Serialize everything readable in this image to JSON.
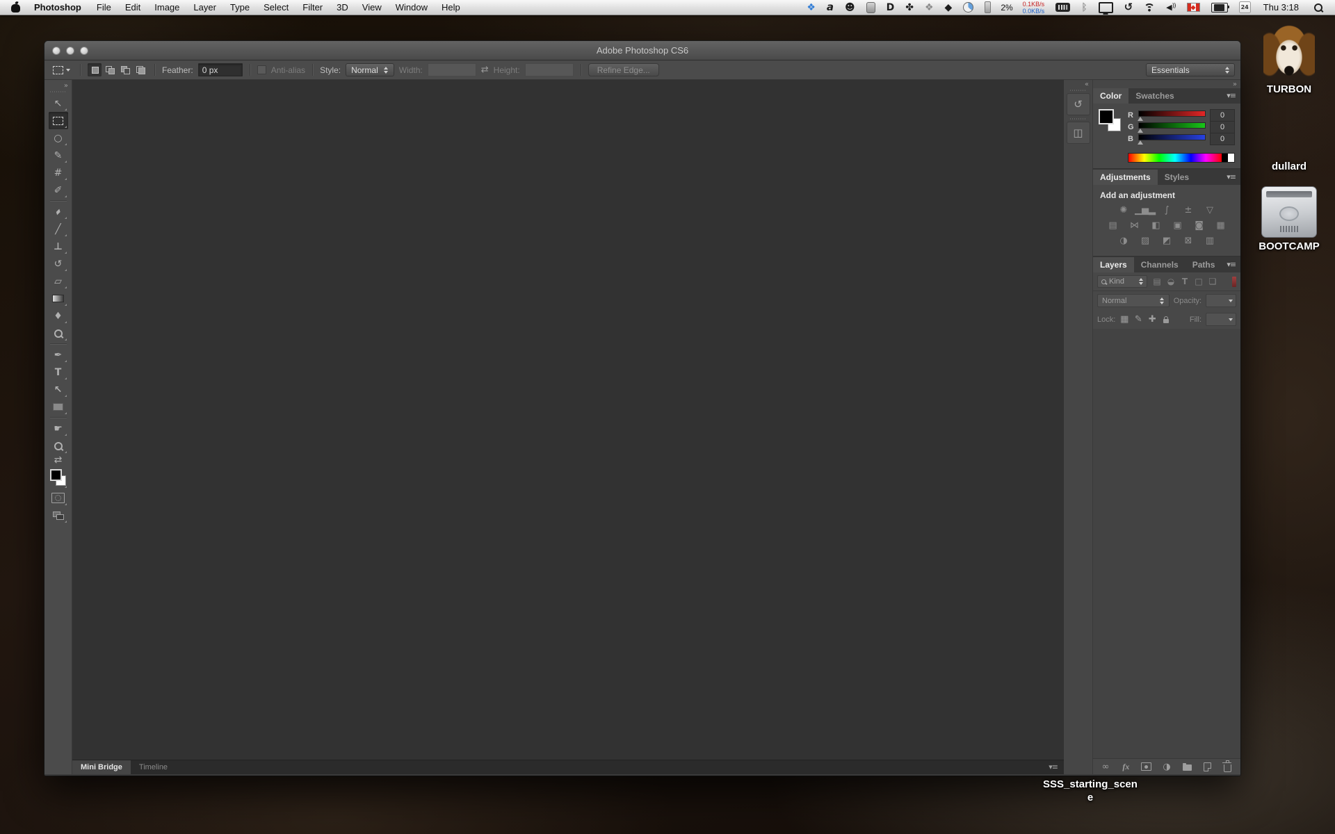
{
  "glyphs": {
    "collapse_right": "»",
    "collapse_left": "«",
    "panel_menu": "▾≡",
    "swap_dims": "⇄"
  },
  "menu_bar": {
    "menus": [
      {
        "name": "menu-photoshop",
        "label": "Photoshop",
        "cls": "bold"
      },
      {
        "name": "menu-file",
        "label": "File",
        "cls": ""
      },
      {
        "name": "menu-edit",
        "label": "Edit",
        "cls": ""
      },
      {
        "name": "menu-image",
        "label": "Image",
        "cls": ""
      },
      {
        "name": "menu-layer",
        "label": "Layer",
        "cls": ""
      },
      {
        "name": "menu-type",
        "label": "Type",
        "cls": ""
      },
      {
        "name": "menu-select",
        "label": "Select",
        "cls": ""
      },
      {
        "name": "menu-filter",
        "label": "Filter",
        "cls": ""
      },
      {
        "name": "menu-3d",
        "label": "3D",
        "cls": ""
      },
      {
        "name": "menu-view",
        "label": "View",
        "cls": ""
      },
      {
        "name": "menu-window",
        "label": "Window",
        "cls": ""
      },
      {
        "name": "menu-help",
        "label": "Help",
        "cls": ""
      }
    ],
    "status_icons_a": [
      {
        "name": "dropbox-icon",
        "glyph": "❖",
        "cls": "c-dropbox"
      },
      {
        "name": "alfred-icon",
        "glyph": "a",
        "cls": "c-dark italic"
      },
      {
        "name": "user-silhouette-icon",
        "glyph": "☻",
        "cls": "c-dark"
      },
      {
        "name": "drive-slab-icon",
        "glyph": "",
        "cls": "shape-slab"
      },
      {
        "name": "d-app-icon",
        "glyph": "D",
        "cls": "c-dark boldg"
      },
      {
        "name": "paw-icon",
        "glyph": "✤",
        "cls": "c-dark"
      },
      {
        "name": "diamond-dots-icon",
        "glyph": "❖",
        "cls": "c-grey"
      },
      {
        "name": "cube-icon",
        "glyph": "◆",
        "cls": "c-dark"
      },
      {
        "name": "pie-chart-icon",
        "glyph": "",
        "cls": "shape-pie"
      },
      {
        "name": "meter-icon",
        "glyph": "",
        "cls": "shape-meter"
      }
    ],
    "cpu_percent": "2%",
    "net_up": "0.1KB/s",
    "net_down": "0.0KB/s",
    "status_icons_b": [
      {
        "name": "memory-icon",
        "glyph": "",
        "cls": "shape-memory"
      },
      {
        "name": "bluetooth-icon",
        "glyph": "ᛒ",
        "cls": "c-dim boldg"
      },
      {
        "name": "display-icon",
        "glyph": "",
        "cls": "shape-display"
      },
      {
        "name": "time-machine-icon",
        "glyph": "↺",
        "cls": "c-dark tm"
      },
      {
        "name": "wifi-icon",
        "glyph": "",
        "cls": "shape-wifi"
      },
      {
        "name": "volume-icon",
        "glyph": "◀",
        "cls": "c-dark vol"
      },
      {
        "name": "canada-flag-icon",
        "glyph": "",
        "cls": "shape-flag"
      },
      {
        "name": "battery-icon",
        "glyph": "",
        "cls": "shape-battery"
      },
      {
        "name": "calendar-icon",
        "glyph": "24",
        "cls": "shape-calendar"
      }
    ],
    "clock": "Thu 3:18"
  },
  "window": {
    "title": "Adobe Photoshop CS6",
    "options_bar": {
      "selection_modes": [
        {
          "name": "new-selection-button",
          "cls": "pressed",
          "shape": "sm-new"
        },
        {
          "name": "add-to-selection-button",
          "cls": "",
          "shape": "sm-add"
        },
        {
          "name": "subtract-from-selection-button",
          "cls": "",
          "shape": "sm-sub"
        },
        {
          "name": "intersect-selection-button",
          "cls": "",
          "shape": "sm-int"
        }
      ],
      "feather_label": "Feather:",
      "feather_value": "0 px",
      "antialias_label": "Anti-alias",
      "style_label": "Style:",
      "style_value": "Normal",
      "width_label": "Width:",
      "height_label": "Height:",
      "refine_edge_label": "Refine Edge...",
      "workspace_value": "Essentials"
    },
    "tools": [
      {
        "name": "move-tool",
        "glyph": "↖",
        "shape": "",
        "cls": ""
      },
      {
        "name": "rectangular-marquee-tool",
        "glyph": "",
        "shape": "shape-marquee",
        "cls": "selected"
      },
      {
        "name": "lasso-tool",
        "glyph": "○",
        "shape": "",
        "cls": ""
      },
      {
        "name": "quick-selection-tool",
        "glyph": "✎",
        "shape": "",
        "cls": ""
      },
      {
        "name": "crop-tool",
        "glyph": "#",
        "shape": "",
        "cls": ""
      },
      {
        "name": "eyedropper-tool",
        "glyph": "✐",
        "shape": "",
        "cls": ""
      },
      {
        "name": "tool-divider",
        "glyph": "",
        "shape": "",
        "cls": "divider"
      },
      {
        "name": "spot-healing-brush-tool",
        "glyph": "▰",
        "shape": "",
        "cls": "rot45"
      },
      {
        "name": "brush-tool",
        "glyph": "╱",
        "shape": "",
        "cls": "boldg"
      },
      {
        "name": "clone-stamp-tool",
        "glyph": "⊥",
        "shape": "",
        "cls": "boldg"
      },
      {
        "name": "history-brush-tool",
        "glyph": "↺",
        "shape": "",
        "cls": ""
      },
      {
        "name": "eraser-tool",
        "glyph": "▱",
        "shape": "",
        "cls": ""
      },
      {
        "name": "gradient-tool",
        "glyph": "",
        "shape": "shape-gradient",
        "cls": ""
      },
      {
        "name": "blur-tool",
        "glyph": "♦",
        "shape": "",
        "cls": ""
      },
      {
        "name": "dodge-tool",
        "glyph": "",
        "shape": "shape-magnifier",
        "cls": ""
      },
      {
        "name": "tool-divider",
        "glyph": "",
        "shape": "",
        "cls": "divider"
      },
      {
        "name": "pen-tool",
        "glyph": "✒",
        "shape": "",
        "cls": ""
      },
      {
        "name": "type-tool",
        "glyph": "T",
        "shape": "",
        "cls": "boldg"
      },
      {
        "name": "path-selection-tool",
        "glyph": "↖",
        "shape": "",
        "cls": "boldg"
      },
      {
        "name": "rectangle-tool",
        "glyph": "",
        "shape": "shape-rect",
        "cls": ""
      },
      {
        "name": "tool-divider",
        "glyph": "",
        "shape": "",
        "cls": "divider"
      },
      {
        "name": "hand-tool",
        "glyph": "☛",
        "shape": "",
        "cls": ""
      },
      {
        "name": "zoom-tool",
        "glyph": "",
        "shape": "shape-magnifier",
        "cls": ""
      },
      {
        "name": "swap-colors-icon",
        "glyph": "⇄",
        "shape": "",
        "cls": "small"
      },
      {
        "name": "foreground-background-swatches",
        "glyph": "",
        "shape": "shape-swatches",
        "cls": "tall"
      },
      {
        "name": "quick-mask-button",
        "glyph": "",
        "shape": "shape-quickmask",
        "cls": ""
      },
      {
        "name": "screen-mode-button",
        "glyph": "",
        "shape": "shape-screenmode",
        "cls": ""
      }
    ],
    "status_tabs": [
      {
        "name": "tab-mini-bridge",
        "label": "Mini Bridge",
        "cls": "active"
      },
      {
        "name": "tab-timeline",
        "label": "Timeline",
        "cls": ""
      }
    ]
  },
  "panels": {
    "dock_icons": [
      {
        "name": "history-panel-button",
        "glyph": "↺"
      },
      {
        "name": "properties-panel-button",
        "glyph": "◫"
      }
    ],
    "color": {
      "tabs": [
        {
          "name": "tab-color",
          "label": "Color",
          "cls": "active"
        },
        {
          "name": "tab-swatches",
          "label": "Swatches",
          "cls": ""
        }
      ],
      "channels": [
        {
          "label": "R",
          "value": "0",
          "cls": "tr-r"
        },
        {
          "label": "G",
          "value": "0",
          "cls": "tr-g"
        },
        {
          "label": "B",
          "value": "0",
          "cls": "tr-b"
        }
      ]
    },
    "adjustments": {
      "tabs": [
        {
          "name": "tab-adjustments",
          "label": "Adjustments",
          "cls": "active"
        },
        {
          "name": "tab-styles",
          "label": "Styles",
          "cls": ""
        }
      ],
      "heading": "Add an adjustment",
      "row1": [
        {
          "name": "brightness-contrast-icon",
          "glyph": "✺"
        },
        {
          "name": "levels-icon",
          "glyph": "▁▅▂"
        },
        {
          "name": "curves-icon",
          "glyph": "∫"
        },
        {
          "name": "exposure-icon",
          "glyph": "±"
        },
        {
          "name": "vibrance-icon",
          "glyph": "▽"
        }
      ],
      "row2": [
        {
          "name": "hue-saturation-icon",
          "glyph": "▤"
        },
        {
          "name": "color-balance-icon",
          "glyph": "⋈"
        },
        {
          "name": "black-white-icon",
          "glyph": "◧"
        },
        {
          "name": "photo-filter-icon",
          "glyph": "▣"
        },
        {
          "name": "channel-mixer-icon",
          "glyph": "◙"
        },
        {
          "name": "color-lookup-icon",
          "glyph": "▦"
        }
      ],
      "row3": [
        {
          "name": "invert-icon",
          "glyph": "◑"
        },
        {
          "name": "posterize-icon",
          "glyph": "▨"
        },
        {
          "name": "threshold-icon",
          "glyph": "◩"
        },
        {
          "name": "selective-color-icon",
          "glyph": "⊠"
        },
        {
          "name": "gradient-map-icon",
          "glyph": "▥"
        }
      ]
    },
    "layers": {
      "tabs": [
        {
          "name": "tab-layers",
          "label": "Layers",
          "cls": "active"
        },
        {
          "name": "tab-channels",
          "label": "Channels",
          "cls": ""
        },
        {
          "name": "tab-paths",
          "label": "Paths",
          "cls": ""
        }
      ],
      "kind_label": "Kind",
      "filter_icons": [
        {
          "name": "filter-pixel-layers-icon",
          "glyph": "▤",
          "cls": ""
        },
        {
          "name": "filter-adjustment-layers-icon",
          "glyph": "◒",
          "cls": ""
        },
        {
          "name": "filter-type-layers-icon",
          "glyph": "T",
          "cls": "boldg"
        },
        {
          "name": "filter-shape-layers-icon",
          "glyph": "□",
          "cls": ""
        },
        {
          "name": "filter-smart-objects-icon",
          "glyph": "❏",
          "cls": ""
        }
      ],
      "blend_mode_value": "Normal",
      "opacity_label": "Opacity:",
      "lock_label": "Lock:",
      "lock_icons": [
        {
          "name": "lock-transparent-pixels-icon",
          "glyph": "▦",
          "cls": ""
        },
        {
          "name": "lock-image-pixels-icon",
          "glyph": "✎",
          "cls": ""
        },
        {
          "name": "lock-position-icon",
          "glyph": "✚",
          "cls": ""
        },
        {
          "name": "lock-all-icon",
          "glyph": "",
          "cls": "shape-lock"
        }
      ],
      "fill_label": "Fill:",
      "bottom_icons": [
        {
          "name": "link-layers-icon",
          "glyph": "∞",
          "cls": ""
        },
        {
          "name": "layer-style-icon",
          "glyph": "fx",
          "cls": "fx"
        },
        {
          "name": "add-layer-mask-icon",
          "glyph": "",
          "cls": "shape-mask"
        },
        {
          "name": "new-adjustment-layer-icon",
          "glyph": "◑",
          "cls": ""
        },
        {
          "name": "new-group-icon",
          "glyph": "",
          "cls": "shape-folder"
        },
        {
          "name": "new-layer-icon",
          "glyph": "",
          "cls": "shape-newlayer"
        },
        {
          "name": "delete-layer-icon",
          "glyph": "",
          "cls": "shape-trash"
        }
      ]
    }
  },
  "desktop": {
    "icons": [
      {
        "name": "desktop-icon-turbon",
        "label": "TURBON",
        "cls": "dog"
      },
      {
        "name": "desktop-icon-dullard",
        "label": "dullard",
        "cls": "art"
      },
      {
        "name": "desktop-icon-bootcamp",
        "label": "BOOTCAMP",
        "cls": "drive"
      }
    ],
    "loose_file_label": "SSS_starting_scene"
  }
}
